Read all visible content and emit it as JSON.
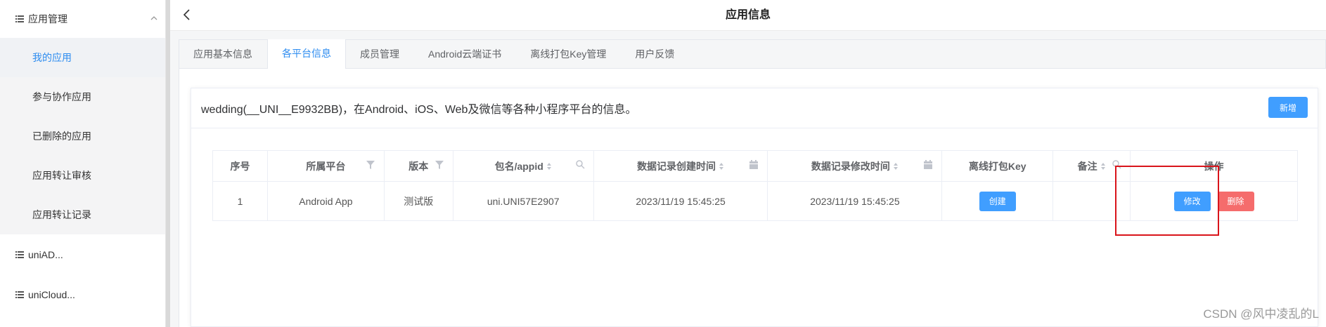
{
  "sidebar": {
    "group_app": {
      "label": "应用管理"
    },
    "submenu": [
      {
        "label": "我的应用",
        "active": true
      },
      {
        "label": "参与协作应用",
        "active": false
      },
      {
        "label": "已删除的应用",
        "active": false
      },
      {
        "label": "应用转让审核",
        "active": false
      },
      {
        "label": "应用转让记录",
        "active": false
      }
    ],
    "group_uniad": {
      "label": "uniAD..."
    },
    "group_unicloud": {
      "label": "uniCloud..."
    }
  },
  "topbar": {
    "title": "应用信息"
  },
  "tabs": [
    {
      "label": "应用基本信息",
      "active": false
    },
    {
      "label": "各平台信息",
      "active": true
    },
    {
      "label": "成员管理",
      "active": false
    },
    {
      "label": "Android云端证书",
      "active": false
    },
    {
      "label": "离线打包Key管理",
      "active": false
    },
    {
      "label": "用户反馈",
      "active": false
    }
  ],
  "card": {
    "description": "wedding(__UNI__E9932BB)，在Android、iOS、Web及微信等各种小程序平台的信息。",
    "add_label": "新增"
  },
  "table": {
    "headers": {
      "index": "序号",
      "platform": "所属平台",
      "version": "版本",
      "package": "包名/appid",
      "created": "数据记录创建时间",
      "modified": "数据记录修改时间",
      "offline_key": "离线打包Key",
      "remark": "备注",
      "actions": "操作"
    },
    "rows": [
      {
        "index": "1",
        "platform": "Android App",
        "version": "测试版",
        "package": "uni.UNI57E2907",
        "created": "2023/11/19 15:45:25",
        "modified": "2023/11/19 15:45:25",
        "create_label": "创建",
        "remark": "",
        "edit_label": "修改",
        "delete_label": "删除"
      }
    ]
  },
  "watermark": "CSDN @风中凌乱的L",
  "colors": {
    "accent": "#409eff",
    "danger": "#f56c6c",
    "highlight": "#d9141b"
  }
}
